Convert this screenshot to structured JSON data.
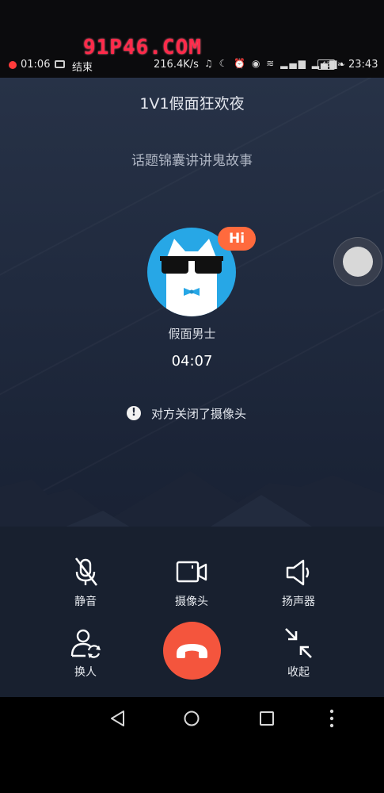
{
  "watermark": "91P46.COM",
  "status_bar": {
    "left_time": "01:06",
    "end_label": "结束",
    "network_speed": "216.4K/s",
    "battery": "43",
    "right_time": "23:43"
  },
  "call": {
    "title": "1V1假面狂欢夜",
    "topic": "话题锦囊讲讲鬼故事",
    "badge": "Hi",
    "name": "假面男士",
    "duration": "04:07",
    "notice": "对方关闭了摄像头"
  },
  "controls": {
    "mute": "静音",
    "camera": "摄像头",
    "speaker": "扬声器",
    "switch": "换人",
    "collapse": "收起"
  },
  "colors": {
    "hangup": "#f4553d",
    "badge": "#ff6a3d",
    "avatar_bg": "#27a7e6"
  },
  "icons": {
    "mute": "mic-off-icon",
    "camera": "video-camera-icon",
    "speaker": "speaker-icon",
    "switch": "switch-user-icon",
    "collapse": "collapse-arrows-icon",
    "hangup": "phone-hangup-icon",
    "nav_back": "back-triangle-icon",
    "nav_home": "home-circle-icon",
    "nav_recent": "recent-square-icon",
    "nav_menu": "more-vertical-icon"
  }
}
